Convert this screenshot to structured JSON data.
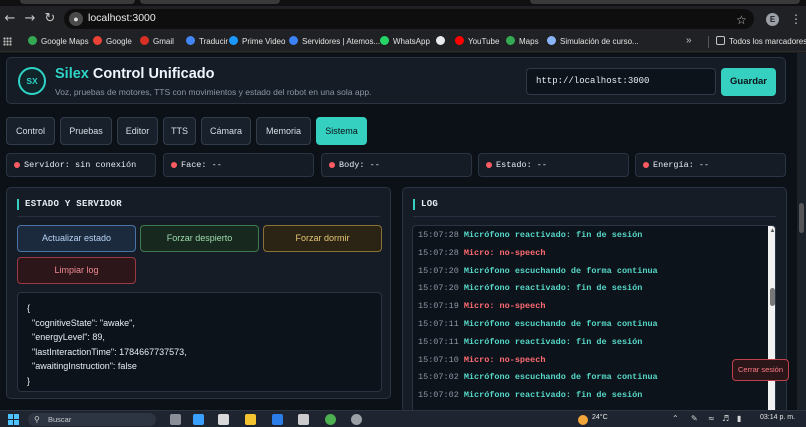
{
  "browser": {
    "url": "localhost:3000",
    "profile_initial": "E",
    "bookmarks": [
      {
        "label": "Google Maps",
        "color": "#34a853"
      },
      {
        "label": "Google",
        "color": "#ea4335"
      },
      {
        "label": "Gmail",
        "color": "#d93025"
      },
      {
        "label": "Traducir",
        "color": "#4285f4"
      },
      {
        "label": "Prime Video",
        "color": "#1a98ff"
      },
      {
        "label": "Servidores | Atemos...",
        "color": "#3b82f6"
      },
      {
        "label": "WhatsApp",
        "color": "#25d366"
      },
      {
        "label": "",
        "color": "#e8eaed"
      },
      {
        "label": "YouTube",
        "color": "#ff0000"
      },
      {
        "label": "Maps",
        "color": "#34a853"
      },
      {
        "label": "Simulación de curso...",
        "color": "#8ab4f8"
      }
    ],
    "more_label": "»",
    "all_bookmarks_label": "Todos los marcadores"
  },
  "header": {
    "logo_text": "SX",
    "title_accent": "Silex",
    "title_rest": " Control Unificado",
    "subtitle": "Voz, pruebas de motores, TTS con movimientos y estado del robot en una sola app.",
    "server_url_value": "http://localhost:3000",
    "connect_label": "Guardar"
  },
  "tabs": [
    {
      "label": "Control",
      "active": false
    },
    {
      "label": "Pruebas",
      "active": false
    },
    {
      "label": "Editor",
      "active": false
    },
    {
      "label": "TTS",
      "active": false
    },
    {
      "label": "Cámara",
      "active": false
    },
    {
      "label": "Memoria",
      "active": false
    },
    {
      "label": "Sistema",
      "active": true
    }
  ],
  "status_chips": [
    {
      "text": "Servidor: sin conexión"
    },
    {
      "text": "Face: --"
    },
    {
      "text": "Body: --"
    },
    {
      "text": "Estado: --"
    },
    {
      "text": "Energía: --"
    }
  ],
  "state_panel": {
    "title": "ESTADO Y SERVIDOR",
    "buttons": {
      "update": "Actualizar estado",
      "wake": "Forzar despierto",
      "sleep": "Forzar dormir",
      "clear_log": "Limpiar log"
    },
    "json_text": "{\n  \"cognitiveState\": \"awake\",\n  \"energyLevel\": 89,\n  \"lastInteractionTime\": 1784667737573,\n  \"awaitingInstruction\": false\n}"
  },
  "log_panel": {
    "title": "LOG",
    "entries": [
      {
        "time": "15:07:28",
        "message": "Micrófono reactivado: fin de sesión",
        "level": "info"
      },
      {
        "time": "15:07:28",
        "message": "Micro: no-speech",
        "level": "warn"
      },
      {
        "time": "15:07:20",
        "message": "Micrófono escuchando de forma continua",
        "level": "info"
      },
      {
        "time": "15:07:20",
        "message": "Micrófono reactivado: fin de sesión",
        "level": "info"
      },
      {
        "time": "15:07:19",
        "message": "Micro: no-speech",
        "level": "warn"
      },
      {
        "time": "15:07:11",
        "message": "Micrófono escuchando de forma continua",
        "level": "info"
      },
      {
        "time": "15:07:11",
        "message": "Micrófono reactivado: fin de sesión",
        "level": "info"
      },
      {
        "time": "15:07:10",
        "message": "Micro: no-speech",
        "level": "warn"
      },
      {
        "time": "15:07:02",
        "message": "Micrófono escuchando de forma continua",
        "level": "info"
      },
      {
        "time": "15:07:02",
        "message": "Micrófono reactivado: fin de sesión",
        "level": "info"
      }
    ]
  },
  "logout_label": "Cerrar sesión",
  "taskbar": {
    "search_label": "Buscar",
    "weather_temp": "24°C",
    "clock": "03:14 p. m."
  },
  "colors": {
    "accent": "#35d0bf",
    "error_dot": "#ff5c62",
    "log_info": "#56d9c8",
    "log_warn": "#ff6b72"
  }
}
